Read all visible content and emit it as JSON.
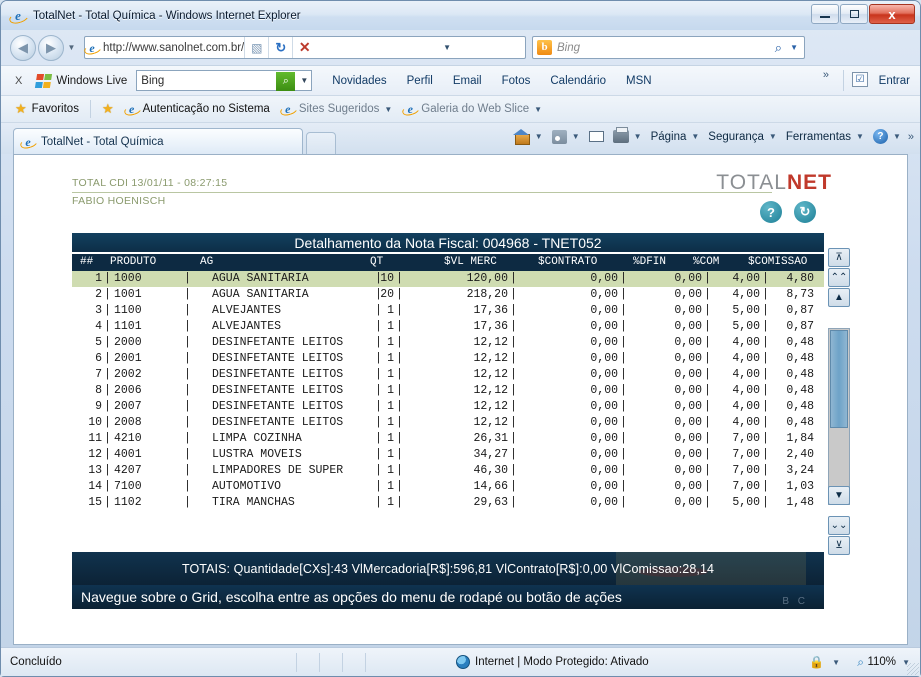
{
  "window": {
    "title": "TotalNet - Total Química - Windows Internet Explorer",
    "minimize_label": "",
    "maximize_label": "",
    "close_label": "x"
  },
  "nav": {
    "back_glyph": "◀",
    "forward_glyph": "▶",
    "history_caret": "▼",
    "address_value": "http://www.sanolnet.com.br/",
    "address_caret": "▼",
    "compat_icon": "compatibility-view-icon",
    "refresh_glyph": "↻",
    "stop_glyph": "✕",
    "search_placeholder": "Bing",
    "search_engine_initial": "b",
    "search_go_glyph": "🔍",
    "search_caret": "▼"
  },
  "windows_live_bar": {
    "close_label": "X",
    "brand": "Windows Live",
    "search_value": "Bing",
    "search_button_glyph": "🔍",
    "search_caret": "▼",
    "links": [
      "Novidades",
      "Perfil",
      "Email",
      "Fotos",
      "Calendário",
      "MSN"
    ],
    "overflow_glyph": "»",
    "signin_label": "Entrar",
    "signin_icon": "checkbox-icon"
  },
  "favorites_bar": {
    "favorites_label": "Favoritos",
    "items": [
      {
        "label": "Autenticação no Sistema",
        "icon": "ie-page-icon",
        "caret": "",
        "grey": false
      },
      {
        "label": "Sites Sugeridos",
        "icon": "ie-page-icon",
        "caret": "▼",
        "grey": true
      },
      {
        "label": "Galeria do Web Slice",
        "icon": "ie-page-icon",
        "caret": "▼",
        "grey": true
      }
    ]
  },
  "tabs": {
    "active_tab_label": "TotalNet - Total Química",
    "new_tab_label": ""
  },
  "command_bar": {
    "items": [
      {
        "label": "",
        "icon": "home-icon",
        "caret": "▼"
      },
      {
        "label": "",
        "icon": "feeds-icon",
        "caret": "▼"
      },
      {
        "label": "",
        "icon": "mail-icon",
        "caret": ""
      },
      {
        "label": "",
        "icon": "print-icon",
        "caret": "▼"
      },
      {
        "label": "Página",
        "icon": "",
        "caret": "▼"
      },
      {
        "label": "Segurança",
        "icon": "",
        "caret": "▼"
      },
      {
        "label": "Ferramentas",
        "icon": "",
        "caret": "▼"
      },
      {
        "label": "",
        "icon": "help-icon",
        "caret": "▼"
      }
    ],
    "overflow_glyph": "»"
  },
  "page": {
    "header_line": "TOTAL CDI 13/01/11 - 08:27:15",
    "user_line": "FABIO HOENISCH",
    "logo_total": "TOTAL",
    "logo_net": "NET",
    "help_icon_glyph": "?",
    "refresh_icon_glyph": "↻",
    "panel_title": "Detalhamento da Nota Fiscal: 004968 - TNET052",
    "columns": [
      "##",
      "PRODUTO",
      "AG",
      "QT",
      "$VL MERC",
      "$CONTRATO",
      "%DFIN",
      "%COM",
      "$COMISSAO"
    ],
    "rows": [
      {
        "n": "1",
        "produto": "1000",
        "ag": "AGUA SANITARIA",
        "qt": "10",
        "vl": "120,00",
        "contrato": "0,00",
        "dfin": "0,00",
        "com": "4,00",
        "comissao": "4,80",
        "selected": true
      },
      {
        "n": "2",
        "produto": "1001",
        "ag": "AGUA SANITARIA",
        "qt": "20",
        "vl": "218,20",
        "contrato": "0,00",
        "dfin": "0,00",
        "com": "4,00",
        "comissao": "8,73",
        "selected": false
      },
      {
        "n": "3",
        "produto": "1100",
        "ag": "ALVEJANTES",
        "qt": "1",
        "vl": "17,36",
        "contrato": "0,00",
        "dfin": "0,00",
        "com": "5,00",
        "comissao": "0,87",
        "selected": false
      },
      {
        "n": "4",
        "produto": "1101",
        "ag": "ALVEJANTES",
        "qt": "1",
        "vl": "17,36",
        "contrato": "0,00",
        "dfin": "0,00",
        "com": "5,00",
        "comissao": "0,87",
        "selected": false
      },
      {
        "n": "5",
        "produto": "2000",
        "ag": "DESINFETANTE LEITOS",
        "qt": "1",
        "vl": "12,12",
        "contrato": "0,00",
        "dfin": "0,00",
        "com": "4,00",
        "comissao": "0,48",
        "selected": false
      },
      {
        "n": "6",
        "produto": "2001",
        "ag": "DESINFETANTE LEITOS",
        "qt": "1",
        "vl": "12,12",
        "contrato": "0,00",
        "dfin": "0,00",
        "com": "4,00",
        "comissao": "0,48",
        "selected": false
      },
      {
        "n": "7",
        "produto": "2002",
        "ag": "DESINFETANTE LEITOS",
        "qt": "1",
        "vl": "12,12",
        "contrato": "0,00",
        "dfin": "0,00",
        "com": "4,00",
        "comissao": "0,48",
        "selected": false
      },
      {
        "n": "8",
        "produto": "2006",
        "ag": "DESINFETANTE LEITOS",
        "qt": "1",
        "vl": "12,12",
        "contrato": "0,00",
        "dfin": "0,00",
        "com": "4,00",
        "comissao": "0,48",
        "selected": false
      },
      {
        "n": "9",
        "produto": "2007",
        "ag": "DESINFETANTE LEITOS",
        "qt": "1",
        "vl": "12,12",
        "contrato": "0,00",
        "dfin": "0,00",
        "com": "4,00",
        "comissao": "0,48",
        "selected": false
      },
      {
        "n": "10",
        "produto": "2008",
        "ag": "DESINFETANTE LEITOS",
        "qt": "1",
        "vl": "12,12",
        "contrato": "0,00",
        "dfin": "0,00",
        "com": "4,00",
        "comissao": "0,48",
        "selected": false
      },
      {
        "n": "11",
        "produto": "4210",
        "ag": "LIMPA COZINHA",
        "qt": "1",
        "vl": "26,31",
        "contrato": "0,00",
        "dfin": "0,00",
        "com": "7,00",
        "comissao": "1,84",
        "selected": false
      },
      {
        "n": "12",
        "produto": "4001",
        "ag": "LUSTRA MOVEIS",
        "qt": "1",
        "vl": "34,27",
        "contrato": "0,00",
        "dfin": "0,00",
        "com": "7,00",
        "comissao": "2,40",
        "selected": false
      },
      {
        "n": "13",
        "produto": "4207",
        "ag": "LIMPADORES DE SUPER",
        "qt": "1",
        "vl": "46,30",
        "contrato": "0,00",
        "dfin": "0,00",
        "com": "7,00",
        "comissao": "3,24",
        "selected": false
      },
      {
        "n": "14",
        "produto": "7100",
        "ag": "AUTOMOTIVO",
        "qt": "1",
        "vl": "14,66",
        "contrato": "0,00",
        "dfin": "0,00",
        "com": "7,00",
        "comissao": "1,03",
        "selected": false
      },
      {
        "n": "15",
        "produto": "1102",
        "ag": "TIRA MANCHAS",
        "qt": "1",
        "vl": "29,63",
        "contrato": "0,00",
        "dfin": "0,00",
        "com": "5,00",
        "comissao": "1,48",
        "selected": false
      }
    ],
    "totals_text": "TOTAIS: Quantidade[CXs]:43   VlMercadoria[R$]:596,81   VlContrato[R$]:0,00   VlComissao:28,14",
    "hint_text": "Navegue sobre o Grid, escolha entre as opções do menu de rodapé ou botão de ações",
    "hint_mark": "B C",
    "scrollbar": {
      "top_glyph": "⊼",
      "page_up_glyph": "⌃⌃",
      "line_up_glyph": "▲",
      "line_down_glyph": "▼",
      "page_down_glyph": "⌄⌄",
      "bottom_glyph": "⊻"
    }
  },
  "status_bar": {
    "status_text": "Concluído",
    "zone_text": "Internet | Modo Protegido: Ativado",
    "zone_icon": "internet-zone-icon",
    "lock_icon": "lock-icon",
    "lock_caret": "▼",
    "zoom_icon": "zoom-icon",
    "zoom_level": "110%",
    "zoom_caret": "▼"
  },
  "colors": {
    "panel_dark": "#0d2a42",
    "selection_green": "#cfdcb1",
    "logo_red": "#c0392b",
    "teal_icon": "#1d7f96",
    "header_olive": "#8a9a6d"
  }
}
